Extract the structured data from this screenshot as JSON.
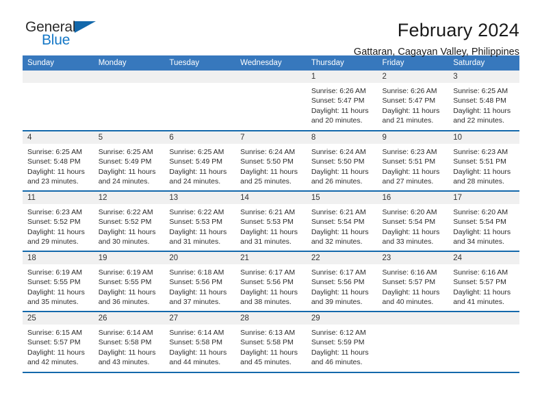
{
  "brand": {
    "logo_word_1": "General",
    "logo_word_2": "Blue",
    "logo_icon": "blue-triangle-icon",
    "color_primary": "#1368ab",
    "color_header": "#3778bd"
  },
  "header": {
    "title": "February 2024",
    "subtitle": "Gattaran, Cagayan Valley, Philippines"
  },
  "calendar": {
    "weekday_headers": [
      "Sunday",
      "Monday",
      "Tuesday",
      "Wednesday",
      "Thursday",
      "Friday",
      "Saturday"
    ],
    "weeks": [
      [
        {
          "day": "",
          "lines": []
        },
        {
          "day": "",
          "lines": []
        },
        {
          "day": "",
          "lines": []
        },
        {
          "day": "",
          "lines": []
        },
        {
          "day": "1",
          "lines": [
            "Sunrise: 6:26 AM",
            "Sunset: 5:47 PM",
            "Daylight: 11 hours",
            "and 20 minutes."
          ]
        },
        {
          "day": "2",
          "lines": [
            "Sunrise: 6:26 AM",
            "Sunset: 5:47 PM",
            "Daylight: 11 hours",
            "and 21 minutes."
          ]
        },
        {
          "day": "3",
          "lines": [
            "Sunrise: 6:25 AM",
            "Sunset: 5:48 PM",
            "Daylight: 11 hours",
            "and 22 minutes."
          ]
        }
      ],
      [
        {
          "day": "4",
          "lines": [
            "Sunrise: 6:25 AM",
            "Sunset: 5:48 PM",
            "Daylight: 11 hours",
            "and 23 minutes."
          ]
        },
        {
          "day": "5",
          "lines": [
            "Sunrise: 6:25 AM",
            "Sunset: 5:49 PM",
            "Daylight: 11 hours",
            "and 24 minutes."
          ]
        },
        {
          "day": "6",
          "lines": [
            "Sunrise: 6:25 AM",
            "Sunset: 5:49 PM",
            "Daylight: 11 hours",
            "and 24 minutes."
          ]
        },
        {
          "day": "7",
          "lines": [
            "Sunrise: 6:24 AM",
            "Sunset: 5:50 PM",
            "Daylight: 11 hours",
            "and 25 minutes."
          ]
        },
        {
          "day": "8",
          "lines": [
            "Sunrise: 6:24 AM",
            "Sunset: 5:50 PM",
            "Daylight: 11 hours",
            "and 26 minutes."
          ]
        },
        {
          "day": "9",
          "lines": [
            "Sunrise: 6:23 AM",
            "Sunset: 5:51 PM",
            "Daylight: 11 hours",
            "and 27 minutes."
          ]
        },
        {
          "day": "10",
          "lines": [
            "Sunrise: 6:23 AM",
            "Sunset: 5:51 PM",
            "Daylight: 11 hours",
            "and 28 minutes."
          ]
        }
      ],
      [
        {
          "day": "11",
          "lines": [
            "Sunrise: 6:23 AM",
            "Sunset: 5:52 PM",
            "Daylight: 11 hours",
            "and 29 minutes."
          ]
        },
        {
          "day": "12",
          "lines": [
            "Sunrise: 6:22 AM",
            "Sunset: 5:52 PM",
            "Daylight: 11 hours",
            "and 30 minutes."
          ]
        },
        {
          "day": "13",
          "lines": [
            "Sunrise: 6:22 AM",
            "Sunset: 5:53 PM",
            "Daylight: 11 hours",
            "and 31 minutes."
          ]
        },
        {
          "day": "14",
          "lines": [
            "Sunrise: 6:21 AM",
            "Sunset: 5:53 PM",
            "Daylight: 11 hours",
            "and 31 minutes."
          ]
        },
        {
          "day": "15",
          "lines": [
            "Sunrise: 6:21 AM",
            "Sunset: 5:54 PM",
            "Daylight: 11 hours",
            "and 32 minutes."
          ]
        },
        {
          "day": "16",
          "lines": [
            "Sunrise: 6:20 AM",
            "Sunset: 5:54 PM",
            "Daylight: 11 hours",
            "and 33 minutes."
          ]
        },
        {
          "day": "17",
          "lines": [
            "Sunrise: 6:20 AM",
            "Sunset: 5:54 PM",
            "Daylight: 11 hours",
            "and 34 minutes."
          ]
        }
      ],
      [
        {
          "day": "18",
          "lines": [
            "Sunrise: 6:19 AM",
            "Sunset: 5:55 PM",
            "Daylight: 11 hours",
            "and 35 minutes."
          ]
        },
        {
          "day": "19",
          "lines": [
            "Sunrise: 6:19 AM",
            "Sunset: 5:55 PM",
            "Daylight: 11 hours",
            "and 36 minutes."
          ]
        },
        {
          "day": "20",
          "lines": [
            "Sunrise: 6:18 AM",
            "Sunset: 5:56 PM",
            "Daylight: 11 hours",
            "and 37 minutes."
          ]
        },
        {
          "day": "21",
          "lines": [
            "Sunrise: 6:17 AM",
            "Sunset: 5:56 PM",
            "Daylight: 11 hours",
            "and 38 minutes."
          ]
        },
        {
          "day": "22",
          "lines": [
            "Sunrise: 6:17 AM",
            "Sunset: 5:56 PM",
            "Daylight: 11 hours",
            "and 39 minutes."
          ]
        },
        {
          "day": "23",
          "lines": [
            "Sunrise: 6:16 AM",
            "Sunset: 5:57 PM",
            "Daylight: 11 hours",
            "and 40 minutes."
          ]
        },
        {
          "day": "24",
          "lines": [
            "Sunrise: 6:16 AM",
            "Sunset: 5:57 PM",
            "Daylight: 11 hours",
            "and 41 minutes."
          ]
        }
      ],
      [
        {
          "day": "25",
          "lines": [
            "Sunrise: 6:15 AM",
            "Sunset: 5:57 PM",
            "Daylight: 11 hours",
            "and 42 minutes."
          ]
        },
        {
          "day": "26",
          "lines": [
            "Sunrise: 6:14 AM",
            "Sunset: 5:58 PM",
            "Daylight: 11 hours",
            "and 43 minutes."
          ]
        },
        {
          "day": "27",
          "lines": [
            "Sunrise: 6:14 AM",
            "Sunset: 5:58 PM",
            "Daylight: 11 hours",
            "and 44 minutes."
          ]
        },
        {
          "day": "28",
          "lines": [
            "Sunrise: 6:13 AM",
            "Sunset: 5:58 PM",
            "Daylight: 11 hours",
            "and 45 minutes."
          ]
        },
        {
          "day": "29",
          "lines": [
            "Sunrise: 6:12 AM",
            "Sunset: 5:59 PM",
            "Daylight: 11 hours",
            "and 46 minutes."
          ]
        },
        {
          "day": "",
          "lines": []
        },
        {
          "day": "",
          "lines": []
        }
      ]
    ]
  }
}
